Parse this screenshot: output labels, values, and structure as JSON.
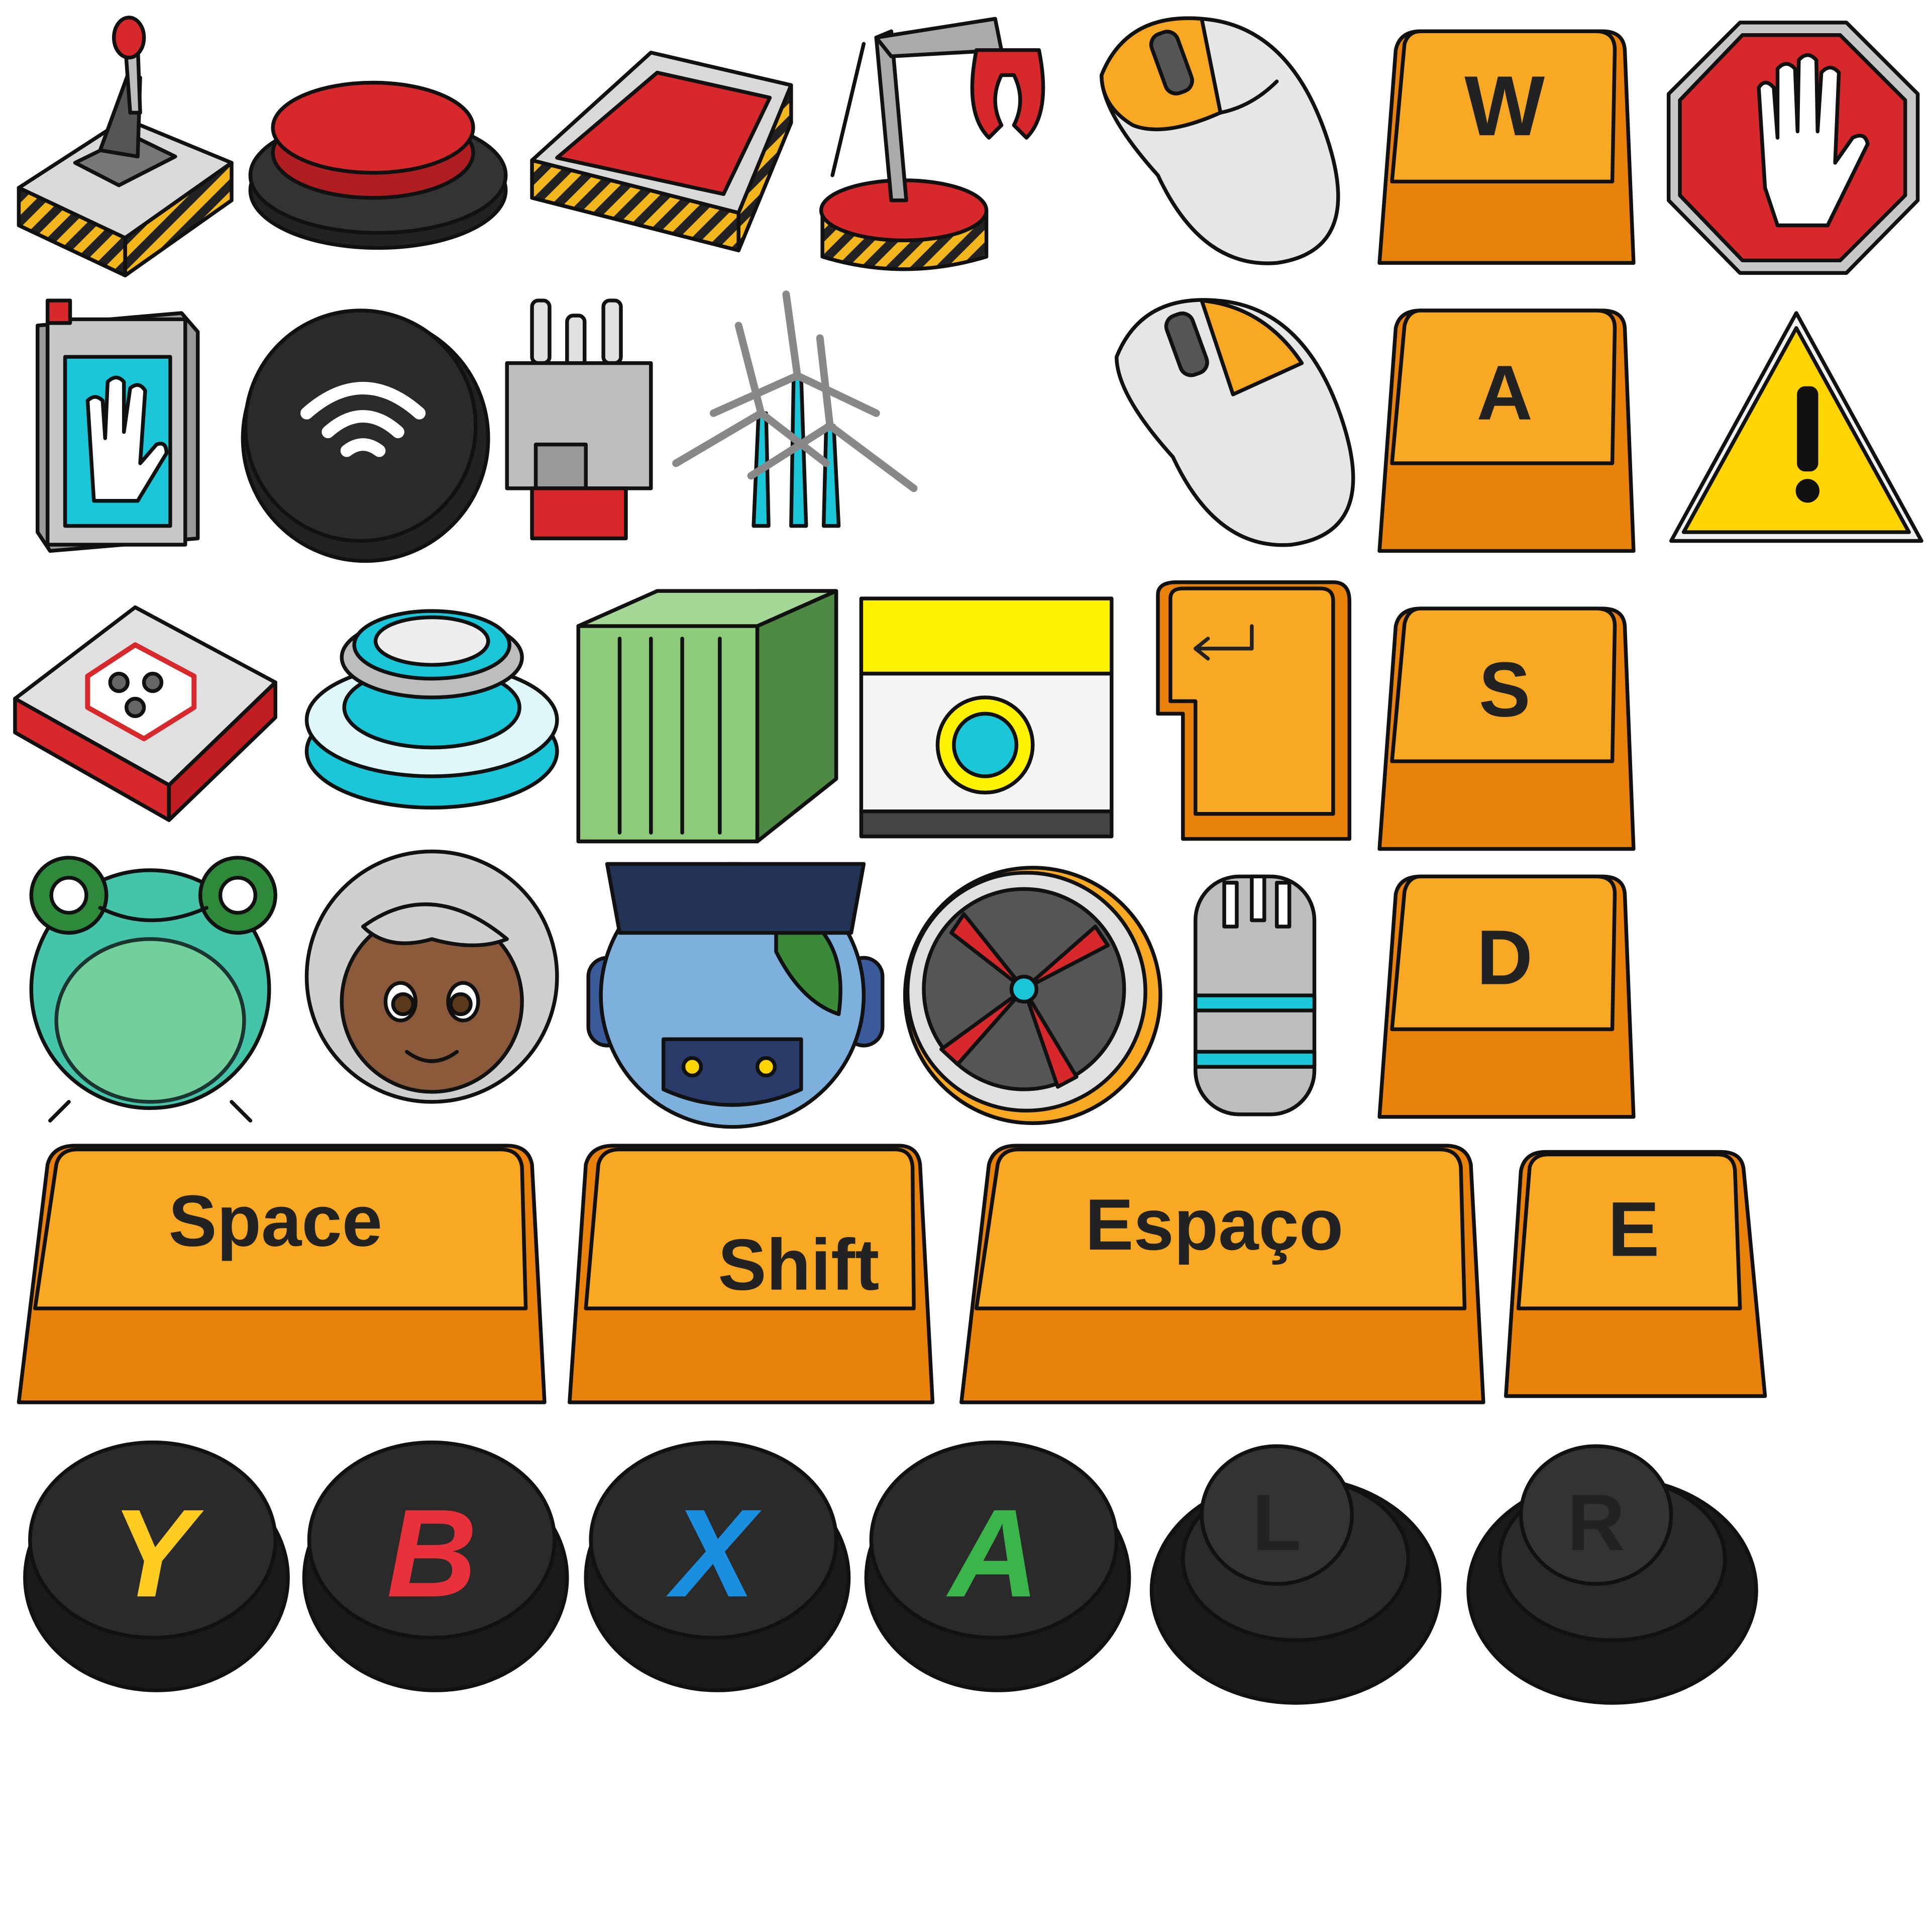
{
  "sheet": {
    "title": "",
    "background": "#ffffff"
  },
  "colors": {
    "outline": "#111111",
    "key_top": "#f9a823",
    "key_side": "#e8820a",
    "red": "#d7282b",
    "dark": "#2a2a2a",
    "cyan": "#1cc6d9",
    "grey_light": "#e6e6e6",
    "yellow_warning": "#ffd400",
    "container_green": "#8dca7a",
    "y_yellow": "#ffcc22",
    "b_red": "#e8313a",
    "x_blue": "#1a8fe0",
    "a_green": "#3ab54a",
    "lr_light": "#dddddd"
  },
  "keys": {
    "w": "W",
    "a": "A",
    "s": "S",
    "d": "D",
    "space": "Space",
    "shift": "Shift",
    "espaco": "Espaço",
    "e": "E"
  },
  "pad": {
    "y": "Y",
    "b": "B",
    "x": "X",
    "a": "A",
    "l": "L",
    "r": "R"
  },
  "icons": [
    "lever-joystick-icon",
    "big-red-button-icon",
    "red-pressure-plate-icon",
    "robot-claw-arm-icon",
    "computer-mouse-left-click-icon",
    "w-key-icon",
    "stop-hand-sign-icon",
    "handprint-scanner-icon",
    "wireless-button-icon",
    "power-plug-icon",
    "wind-turbines-icon",
    "computer-mouse-right-click-icon",
    "a-key-icon",
    "warning-sign-icon",
    "floor-socket-plate-icon",
    "cyan-pressure-button-icon",
    "shipping-container-icon",
    "yellow-machine-block-icon",
    "enter-key-icon",
    "s-key-icon",
    "frog-character-icon",
    "grandma-character-icon",
    "globe-robot-icon",
    "fan-turbine-icon",
    "connector-plug-icon",
    "d-key-icon",
    "space-key-icon",
    "shift-key-icon",
    "espaco-key-icon",
    "e-key-icon",
    "gamepad-y-button-icon",
    "gamepad-b-button-icon",
    "gamepad-x-button-icon",
    "gamepad-a-button-icon",
    "gamepad-l-stick-icon",
    "gamepad-r-stick-icon"
  ]
}
